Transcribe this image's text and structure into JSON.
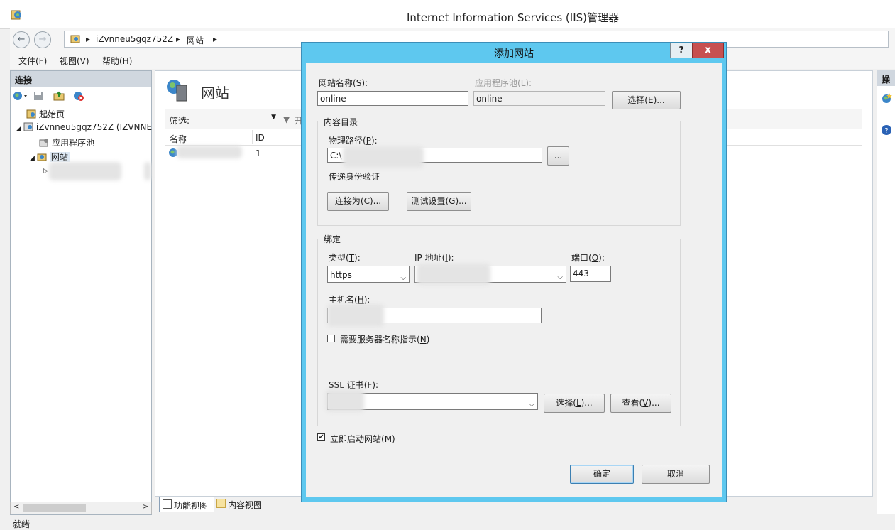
{
  "window": {
    "title": "Internet Information Services (IIS)管理器"
  },
  "address": {
    "server": "iZvnneu5gqz752Z",
    "sep": "▸",
    "node": "网站",
    "end": "▸"
  },
  "menu": {
    "file": "文件(F)",
    "view": "视图(V)",
    "help": "帮助(H)"
  },
  "left": {
    "header": "连接",
    "tree": {
      "start": "起始页",
      "server": "iZvnneu5gqz752Z (IZVNNE",
      "app_pools": "应用程序池",
      "sites": "网站"
    }
  },
  "center": {
    "title": "网站",
    "filter_label": "筛选:",
    "filter_start": "开",
    "columns": {
      "name": "名称",
      "id": "ID"
    },
    "row_id": "1"
  },
  "bottom_tabs": {
    "features": "功能视图",
    "content": "内容视图"
  },
  "right": {
    "header": "操作"
  },
  "status": "就绪",
  "dialog": {
    "title": "添加网站",
    "help": "?",
    "close": "x",
    "site_name_label": "网站名称(S):",
    "site_name_value": "online",
    "app_pool_label": "应用程序池(L):",
    "app_pool_value": "online",
    "select_button": "选择(E)...",
    "content_dir_group": "内容目录",
    "physical_path_label": "物理路径(P):",
    "physical_path_value": "C:\\",
    "browse_button": "...",
    "pass_through_label": "传递身份验证",
    "connect_as_button": "连接为(C)...",
    "test_settings_button": "测试设置(G)...",
    "binding_group": "绑定",
    "type_label": "类型(T):",
    "type_value": "https",
    "ip_label": "IP 地址(I):",
    "port_label": "端口(O):",
    "port_value": "443",
    "hostname_label": "主机名(H):",
    "sni_label": "需要服务器名称指示(N)",
    "sni_checked": false,
    "ssl_label": "SSL 证书(F):",
    "ssl_select_button": "选择(L)...",
    "ssl_view_button": "查看(V)...",
    "start_now_label": "立即启动网站(M)",
    "start_now_checked": true,
    "ok_button": "确定",
    "cancel_button": "取消"
  },
  "colors": {
    "dialog_frame": "#5ec8ef",
    "close_button": "#c75050"
  }
}
